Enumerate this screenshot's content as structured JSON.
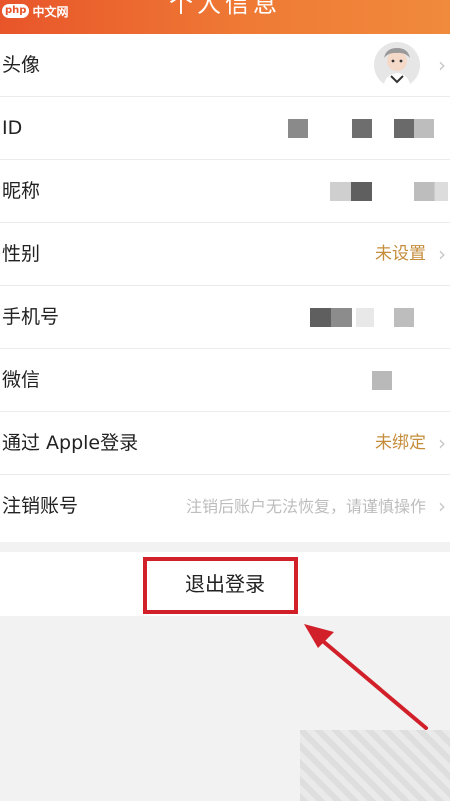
{
  "header": {
    "title": "个人信息",
    "logo_php": "php",
    "logo_cn": "中文网"
  },
  "rows": [
    {
      "label": "头像"
    },
    {
      "label": "ID"
    },
    {
      "label": "昵称"
    },
    {
      "label": "性别",
      "value": "未设置"
    },
    {
      "label": "手机号"
    },
    {
      "label": "微信"
    },
    {
      "label": "通过 Apple登录",
      "value": "未绑定"
    },
    {
      "label": "注销账号",
      "value": "注销后账户无法恢复，请谨慎操作"
    }
  ],
  "logout": {
    "label": "退出登录"
  },
  "colors": {
    "accent": "#c58d3b",
    "header": "#ef7a35",
    "highlight": "#d2202a"
  },
  "icons": {
    "chevron": "chevron-right-icon",
    "avatar": "avatar"
  }
}
